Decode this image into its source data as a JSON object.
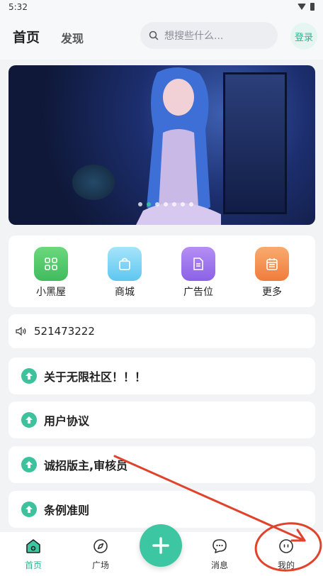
{
  "status_bar": {
    "time": "5:32"
  },
  "header": {
    "tabs": [
      {
        "label": "首页"
      },
      {
        "label": "发现"
      }
    ],
    "search": {
      "placeholder": "想搜些什么..."
    },
    "login_label": "登录"
  },
  "banner": {
    "pages": 7,
    "active_index": 1
  },
  "quick_actions": [
    {
      "label": "小黑屋",
      "icon": "grid-icon",
      "color": "#4cc76a"
    },
    {
      "label": "商城",
      "icon": "bag-icon",
      "color": "#7fd3f3"
    },
    {
      "label": "广告位",
      "icon": "document-icon",
      "color": "#9b73ee"
    },
    {
      "label": "更多",
      "icon": "calendar-icon",
      "color": "#f6914f"
    }
  ],
  "notice": {
    "text": "521473222"
  },
  "posts": [
    {
      "title": "关于无限社区！！！"
    },
    {
      "title": "用户协议"
    },
    {
      "title": "诚招版主,审核员"
    },
    {
      "title": "条例准则"
    }
  ],
  "bottom_nav": [
    {
      "label": "首页",
      "icon": "home-icon"
    },
    {
      "label": "广场",
      "icon": "compass-icon"
    },
    {
      "label": "消息",
      "icon": "chat-icon"
    },
    {
      "label": "我的",
      "icon": "profile-icon"
    }
  ],
  "colors": {
    "accent": "#36c0a3",
    "annotation": "#e0432b"
  }
}
